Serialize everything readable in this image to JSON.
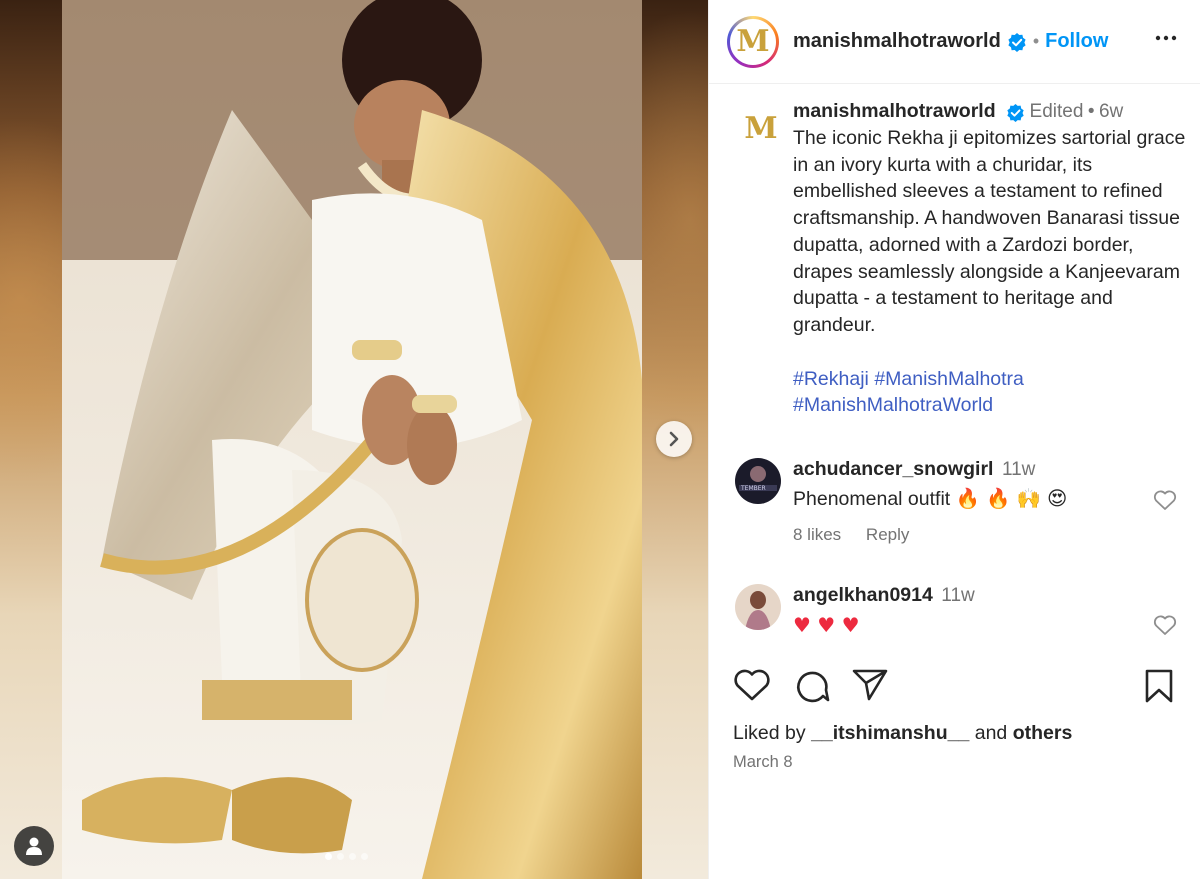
{
  "post": {
    "image_alt": "Rekha in ivory kurta with golden dupatta",
    "carousel_dots": 4,
    "active_dot": 0
  },
  "header": {
    "logo_letter": "M",
    "username": "manishmalhotraworld",
    "separator": "•",
    "follow_label": "Follow"
  },
  "caption": {
    "logo_letter": "M",
    "username": "manishmalhotraworld",
    "edited": "Edited",
    "dot": "•",
    "time": "6w",
    "text": "The iconic Rekha ji epitomizes sartorial grace in an ivory kurta with a churidar, its embellished sleeves a testament to refined craftsmanship. A handwoven Banarasi tissue dupatta, adorned with a Zardozi border, drapes seamlessly alongside a Kanjeevaram dupatta - a testament to heritage and grandeur.",
    "hashtags": [
      "#Rekhaji",
      "#ManishMalhotra",
      "#ManishMalhotraWorld"
    ]
  },
  "comments": [
    {
      "username": "achudancer_snowgirl",
      "time": "11w",
      "text": "Phenomenal outfit",
      "emojis": "🔥 🔥 🙌 😍",
      "likes": "8 likes",
      "reply": "Reply"
    },
    {
      "username": "angelkhan0914",
      "time": "11w",
      "text": "",
      "emojis": "♥ ♥ ♥"
    }
  ],
  "footer": {
    "liked_by_prefix": "Liked by",
    "liked_by_user": "__itshimanshu__",
    "and": "and",
    "others": "others",
    "date": "March 8"
  },
  "icons": {
    "header_more": "more-horizontal-icon",
    "verified": "verified-badge-icon",
    "next": "chevron-right-icon",
    "user_tag": "user-tag-icon",
    "like": "heart-icon",
    "comment": "comment-icon",
    "share": "share-icon",
    "save": "bookmark-icon"
  },
  "colors": {
    "accent": "#0095f6",
    "hashtag": "#3f5ec2",
    "brand_gold": "#c9a13b",
    "muted": "#737373"
  }
}
